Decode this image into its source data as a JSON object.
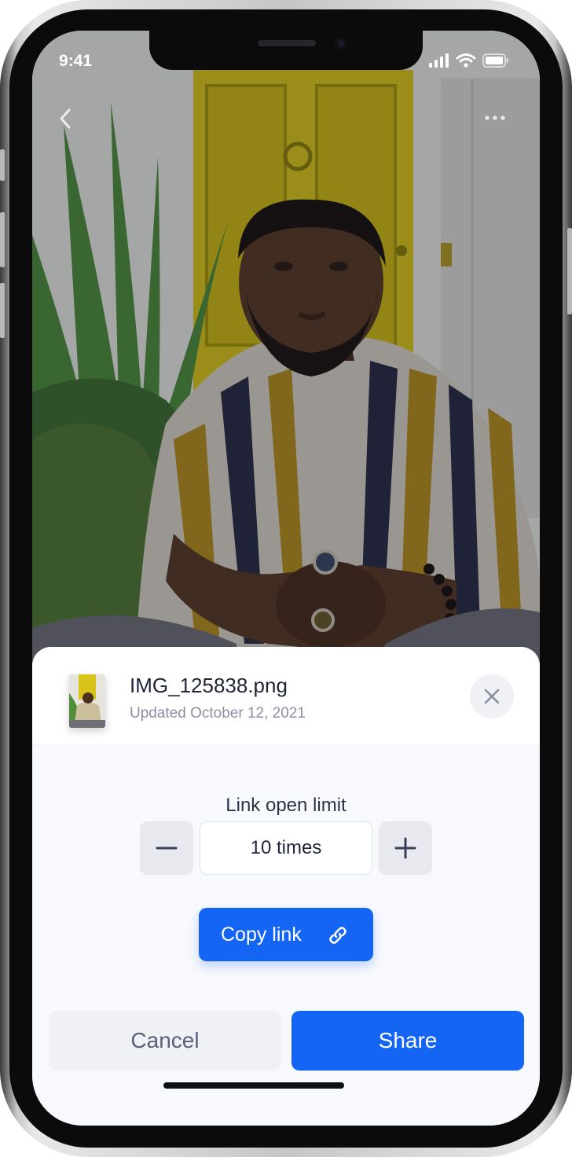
{
  "status_bar": {
    "time": "9:41"
  },
  "nav": {
    "back_icon": "chevron-left-icon",
    "more_icon": "more-horizontal-icon"
  },
  "file": {
    "name": "IMG_125838.png",
    "updated": "Updated October 12, 2021"
  },
  "link_limit": {
    "label": "Link open limit",
    "value": "10 times"
  },
  "actions": {
    "copy_link": "Copy link",
    "cancel": "Cancel",
    "share": "Share"
  },
  "colors": {
    "primary": "#1565f5",
    "text_dark": "#1f2437",
    "text_muted": "#8a90a2",
    "door_yellow": "#d8c41a"
  }
}
